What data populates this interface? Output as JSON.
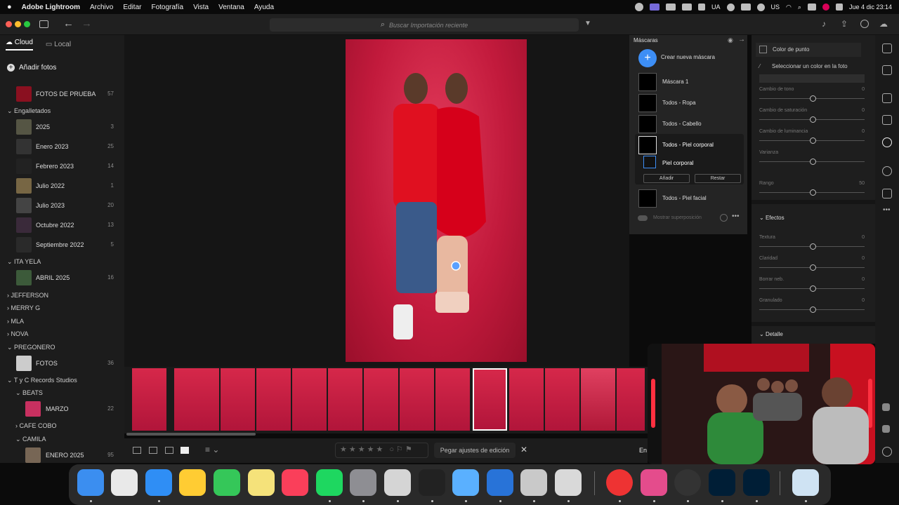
{
  "menubar": {
    "app": "Adobe Lightroom",
    "items": [
      "Archivo",
      "Editar",
      "Fotografía",
      "Vista",
      "Ventana",
      "Ayuda"
    ],
    "tray_labels": [
      "UA",
      "US"
    ],
    "datetime": "Jue 4 dic  23:14"
  },
  "titlebar": {
    "search_placeholder": "Buscar Importación reciente"
  },
  "sidebar": {
    "tab_cloud": "Cloud",
    "tab_local": "Local",
    "add_photos": "Añadir fotos",
    "albums": [
      {
        "name": "FOTOS DE PRUEBA",
        "count": "57"
      },
      {
        "name": "2025",
        "count": "3"
      },
      {
        "name": "Enero 2023",
        "count": "25"
      },
      {
        "name": "Febrero 2023",
        "count": "14"
      },
      {
        "name": "Julio 2022",
        "count": "1"
      },
      {
        "name": "Julio 2023",
        "count": "20"
      },
      {
        "name": "Octubre 2022",
        "count": "13"
      },
      {
        "name": "Septiembre 2022",
        "count": "5"
      },
      {
        "name": "ABRIL 2025",
        "count": "16"
      },
      {
        "name": "FOTOS",
        "count": "36"
      },
      {
        "name": "MARZO",
        "count": "22"
      },
      {
        "name": "ENERO 2025",
        "count": "95"
      }
    ],
    "groups": [
      "Engalletados",
      "ITA YELA",
      "JEFFERSON",
      "MERRY G",
      "MLA",
      "NOVA",
      "PREGONERO",
      "T y C Records Studios",
      "BEATS",
      "CAFE COBO",
      "CAMILA"
    ]
  },
  "masks": {
    "title": "Máscaras",
    "create": "Crear nueva máscara",
    "items": [
      "Máscara 1",
      "Todos - Ropa",
      "Todos - Cabello",
      "Todos - Piel corporal",
      "Piel corporal",
      "Todos - Piel facial"
    ],
    "add": "Añadir",
    "subtract": "Restar",
    "overlay": "Mostrar superposición"
  },
  "right": {
    "point_color": "Color de punto",
    "pick_color": "Seleccionar un color en la foto",
    "color_sliders": [
      {
        "label": "Cambio de tono",
        "value": "0"
      },
      {
        "label": "Cambio de saturación",
        "value": "0"
      },
      {
        "label": "Cambio de luminancia",
        "value": "0"
      },
      {
        "label": "Varianza",
        "value": ""
      },
      {
        "label": "Rango",
        "value": "50"
      }
    ],
    "effects": "Efectos",
    "effect_sliders": [
      {
        "label": "Textura",
        "value": "0"
      },
      {
        "label": "Claridad",
        "value": "0"
      },
      {
        "label": "Borrar neb.",
        "value": "0"
      },
      {
        "label": "Granulado",
        "value": "0"
      }
    ],
    "detail": "Detalle"
  },
  "bottom": {
    "paste": "Pegar ajustes de edición",
    "en": "En"
  },
  "dock": {
    "colors": [
      "#3b8ef0",
      "#e9e9e9",
      "#2f8ef5",
      "#ffcc33",
      "#35c759",
      "#f5e27a",
      "#fa3f5a",
      "#1ed760",
      "#8e8e93",
      "#d5d5d5",
      "#222",
      "#5ab0ff",
      "#2873d8",
      "#c9c9c9",
      "#d9d9d9",
      "#e33",
      "#e44c8c",
      "#333",
      "#001e36",
      "#001e36",
      "#cfe3f3"
    ]
  }
}
